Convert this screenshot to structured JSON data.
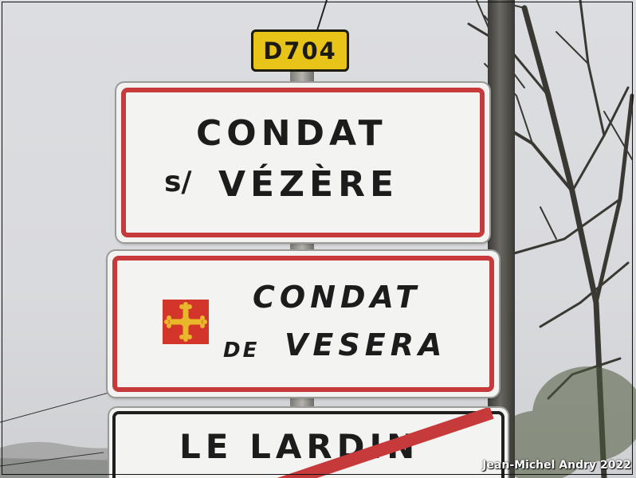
{
  "route_plate": {
    "text": "D704",
    "color": "#e8c318"
  },
  "sign_french": {
    "line1": "CONDAT",
    "prefix": "s/",
    "line2": "VÉZÈRE",
    "border_color": "#c63a3b"
  },
  "sign_occitan": {
    "line1": "CONDAT",
    "line2_prefix": "DE",
    "line2": "VESERA",
    "emblem": "occitan-cross-icon",
    "emblem_color": "#d3352a"
  },
  "sign_exit": {
    "text": "LE LARDIN",
    "strike_color": "#c63a3b"
  },
  "credit": "Jean-Michel Andry 2022"
}
